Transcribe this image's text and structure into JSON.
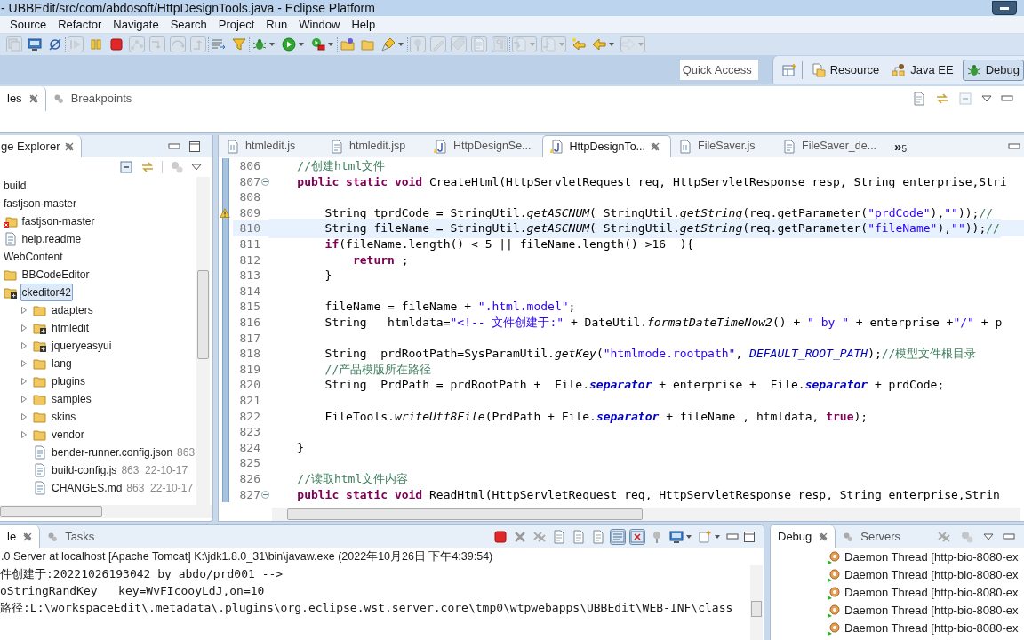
{
  "window": {
    "title": "- UBBEdit/src/com/abdosoft/HttpDesignTools.java - Eclipse Platform"
  },
  "menu": [
    "Source",
    "Refactor",
    "Navigate",
    "Search",
    "Project",
    "Run",
    "Window",
    "Help"
  ],
  "toolbar": [
    [
      {
        "kind": "pages",
        "disabled": true,
        "menu": false
      },
      {
        "kind": "monitor",
        "disabled": false,
        "menu": false
      },
      {
        "kind": "unlink",
        "disabled": false,
        "menu": false
      }
    ],
    [
      {
        "kind": "resume",
        "disabled": true,
        "menu": false
      },
      {
        "kind": "pause",
        "disabled": false,
        "menu": false
      },
      {
        "kind": "stop",
        "disabled": false,
        "menu": false
      },
      {
        "kind": "nodes",
        "disabled": true,
        "menu": false
      },
      {
        "kind": "step-into",
        "disabled": true,
        "menu": false
      },
      {
        "kind": "step-over",
        "disabled": true,
        "menu": false
      },
      {
        "kind": "step-return",
        "disabled": true,
        "menu": false
      }
    ],
    [
      {
        "kind": "list",
        "disabled": false,
        "menu": false
      },
      {
        "kind": "filter",
        "disabled": false,
        "menu": false
      }
    ],
    [
      {
        "kind": "bug",
        "disabled": false,
        "menu": true
      },
      {
        "kind": "run",
        "disabled": false,
        "menu": true
      },
      {
        "kind": "run-tool",
        "disabled": false,
        "menu": true
      }
    ],
    [
      {
        "kind": "folder-new",
        "disabled": false,
        "menu": false
      },
      {
        "kind": "folder",
        "disabled": false,
        "menu": false
      },
      {
        "kind": "brush",
        "disabled": false,
        "menu": true
      }
    ],
    [
      {
        "kind": "pin",
        "disabled": true,
        "menu": false
      },
      {
        "kind": "pen",
        "disabled": true,
        "menu": false
      },
      {
        "kind": "tag",
        "disabled": true,
        "menu": false
      },
      {
        "kind": "doc",
        "disabled": true,
        "menu": false
      },
      {
        "kind": "para",
        "disabled": true,
        "menu": false
      }
    ],
    [
      {
        "kind": "doc-down",
        "disabled": true,
        "menu": true
      },
      {
        "kind": "doc-up",
        "disabled": true,
        "menu": true
      },
      {
        "kind": "arrow-star",
        "disabled": false,
        "menu": false
      },
      {
        "kind": "arrow-left",
        "disabled": false,
        "menu": true
      },
      {
        "kind": "arrow-right",
        "disabled": true,
        "menu": true
      }
    ]
  ],
  "quick_access": {
    "placeholder": "Quick Access"
  },
  "perspectives": [
    {
      "label": "Resource",
      "kind": "resource",
      "selected": false
    },
    {
      "label": "Java EE",
      "kind": "javaee",
      "selected": false
    },
    {
      "label": "Debug",
      "kind": "bug",
      "selected": true
    }
  ],
  "top_view": {
    "tabs": [
      {
        "label": "les",
        "selected": true,
        "closable": true
      },
      {
        "label": "Breakpoints",
        "selected": false,
        "closable": false
      }
    ]
  },
  "package_explorer": {
    "title": "ge Explorer",
    "items": [
      {
        "label": "build",
        "selected": false
      },
      {
        "label": "fastjson-master",
        "selected": false,
        "children": [
          {
            "label": "fastjson-master",
            "kind": "project",
            "selected": false
          },
          {
            "label": "help.readme",
            "kind": "file",
            "selected": false
          }
        ]
      },
      {
        "label": "WebContent",
        "selected": false,
        "children": [
          {
            "label": "BBCodeEditor",
            "kind": "folder",
            "selected": false
          },
          {
            "label": "ckeditor42",
            "kind": "package",
            "selected": true,
            "children": [
              {
                "label": "adapters",
                "kind": "folder",
                "selected": false,
                "expanded": false
              },
              {
                "label": "htmledit",
                "kind": "package",
                "selected": false,
                "expanded": false
              },
              {
                "label": "jqueryeasyui",
                "kind": "package",
                "selected": false,
                "expanded": false
              },
              {
                "label": "lang",
                "kind": "folder",
                "selected": false,
                "expanded": false
              },
              {
                "label": "plugins",
                "kind": "folder",
                "selected": false,
                "expanded": false
              },
              {
                "label": "samples",
                "kind": "folder",
                "selected": false,
                "expanded": false
              },
              {
                "label": "skins",
                "kind": "folder",
                "selected": false,
                "expanded": false
              },
              {
                "label": "vendor",
                "kind": "folder",
                "selected": false,
                "expanded": false
              },
              {
                "label": "bender-runner.config.json",
                "suffix": "863",
                "kind": "file",
                "selected": false
              },
              {
                "label": "build-config.js",
                "suffix": "863  22-10-17",
                "kind": "file",
                "selected": false
              },
              {
                "label": "CHANGES.md",
                "suffix": "863  22-10-17",
                "kind": "file",
                "selected": false
              }
            ]
          }
        ]
      }
    ]
  },
  "editor": {
    "tabs": [
      {
        "label": "htmledit.js",
        "selected": false
      },
      {
        "label": "htmledit.jsp",
        "selected": false
      },
      {
        "label": "HttpDesignSe...",
        "selected": false
      },
      {
        "label": "HttpDesignTo...",
        "selected": true
      },
      {
        "label": "FileSaver.js",
        "selected": false
      },
      {
        "label": "FileSaver_de...",
        "selected": false
      }
    ],
    "overflow": {
      "glyph": "»",
      "count": "5"
    },
    "lines": [
      {
        "no": "806",
        "kind": "plain",
        "current": false,
        "tokens": [
          {
            "kind": "com",
            "text": "    //创建html文件"
          }
        ]
      },
      {
        "no": "807",
        "kind": "fold",
        "current": false,
        "tokens": [
          {
            "kind": "kw",
            "text": "    public static void"
          },
          {
            "kind": "p",
            "text": " CreateHtml(HttpServletRequest req, HttpServletResponse resp, String enterprise,Stri"
          }
        ]
      },
      {
        "no": "808",
        "kind": "plain",
        "current": false
      },
      {
        "no": "809",
        "kind": "warning",
        "current": false,
        "tokens": [
          {
            "kind": "p",
            "text": "        String "
          },
          {
            "kind": "warn",
            "text": "tprdCode"
          },
          {
            "kind": "p",
            "text": " = StringUtil."
          },
          {
            "kind": "sm",
            "text": "getASCNUM"
          },
          {
            "kind": "p",
            "text": "( StringUtil."
          },
          {
            "kind": "sm",
            "text": "getString"
          },
          {
            "kind": "p",
            "text": "(req.getParameter("
          },
          {
            "kind": "str",
            "text": "\"prdCode\""
          },
          {
            "kind": "p",
            "text": "),"
          },
          {
            "kind": "str",
            "text": "\"\""
          },
          {
            "kind": "p",
            "text": "));"
          },
          {
            "kind": "com",
            "text": "//"
          }
        ]
      },
      {
        "no": "810",
        "kind": "plain",
        "current": true,
        "tokens": [
          {
            "kind": "p",
            "text": "        String fileName = StringUtil."
          },
          {
            "kind": "sm",
            "text": "getASCNUM"
          },
          {
            "kind": "p",
            "text": "( StringUtil."
          },
          {
            "kind": "sm",
            "text": "getString"
          },
          {
            "kind": "p",
            "text": "(req.getParameter("
          },
          {
            "kind": "str",
            "text": "\"fileName\""
          },
          {
            "kind": "p",
            "text": "),"
          },
          {
            "kind": "str",
            "text": "\"\""
          },
          {
            "kind": "p",
            "text": "));"
          },
          {
            "kind": "com",
            "text": "//"
          }
        ]
      },
      {
        "no": "811",
        "kind": "plain",
        "current": false,
        "tokens": [
          {
            "kind": "kw",
            "text": "        if"
          },
          {
            "kind": "p",
            "text": "(fileName.length() < 5 || fileName.length() >16  ){"
          }
        ]
      },
      {
        "no": "812",
        "kind": "plain",
        "current": false,
        "tokens": [
          {
            "kind": "kw",
            "text": "            return"
          },
          {
            "kind": "p",
            "text": " ;"
          }
        ]
      },
      {
        "no": "813",
        "kind": "plain",
        "current": false,
        "tokens": [
          {
            "kind": "p",
            "text": "        }"
          }
        ]
      },
      {
        "no": "814",
        "kind": "plain",
        "current": false
      },
      {
        "no": "815",
        "kind": "plain",
        "current": false,
        "tokens": [
          {
            "kind": "p",
            "text": "        fileName = fileName + "
          },
          {
            "kind": "str",
            "text": "\".html.model\""
          },
          {
            "kind": "p",
            "text": ";"
          }
        ]
      },
      {
        "no": "816",
        "kind": "plain",
        "current": false,
        "tokens": [
          {
            "kind": "p",
            "text": "        String   htmldata="
          },
          {
            "kind": "str",
            "text": "\"<!-- 文件创建于:\""
          },
          {
            "kind": "p",
            "text": " + DateUtil."
          },
          {
            "kind": "sm",
            "text": "formatDateTimeNow2"
          },
          {
            "kind": "p",
            "text": "() + "
          },
          {
            "kind": "str",
            "text": "\" by \""
          },
          {
            "kind": "p",
            "text": " + enterprise +"
          },
          {
            "kind": "str",
            "text": "\"/\""
          },
          {
            "kind": "p",
            "text": " + p"
          }
        ]
      },
      {
        "no": "817",
        "kind": "plain",
        "current": false
      },
      {
        "no": "818",
        "kind": "plain",
        "current": false,
        "tokens": [
          {
            "kind": "p",
            "text": "        String  prdRootPath=SysParamUtil."
          },
          {
            "kind": "sm",
            "text": "getKey"
          },
          {
            "kind": "p",
            "text": "("
          },
          {
            "kind": "str",
            "text": "\"htmlmode.rootpath\""
          },
          {
            "kind": "p",
            "text": ", "
          },
          {
            "kind": "cn",
            "text": "DEFAULT_ROOT_PATH"
          },
          {
            "kind": "p",
            "text": ");"
          },
          {
            "kind": "com",
            "text": "//模型文件根目录"
          }
        ]
      },
      {
        "no": "819",
        "kind": "plain",
        "current": false,
        "tokens": [
          {
            "kind": "com",
            "text": "        //产品模版所在路径"
          }
        ]
      },
      {
        "no": "820",
        "kind": "plain",
        "current": false,
        "tokens": [
          {
            "kind": "p",
            "text": "        String  PrdPath = prdRootPath +  File."
          },
          {
            "kind": "sf",
            "text": "separator"
          },
          {
            "kind": "p",
            "text": " + enterprise +  File."
          },
          {
            "kind": "sf",
            "text": "separator"
          },
          {
            "kind": "p",
            "text": " + prdCode;"
          }
        ]
      },
      {
        "no": "821",
        "kind": "plain",
        "current": false
      },
      {
        "no": "822",
        "kind": "plain",
        "current": false,
        "tokens": [
          {
            "kind": "p",
            "text": "        FileTools."
          },
          {
            "kind": "sm",
            "text": "writeUtf8File"
          },
          {
            "kind": "p",
            "text": "(PrdPath + File."
          },
          {
            "kind": "sf",
            "text": "separator"
          },
          {
            "kind": "p",
            "text": " + fileName , htmldata, "
          },
          {
            "kind": "kw",
            "text": "true"
          },
          {
            "kind": "p",
            "text": ");"
          }
        ]
      },
      {
        "no": "823",
        "kind": "plain",
        "current": false
      },
      {
        "no": "824",
        "kind": "plain",
        "current": false,
        "tokens": [
          {
            "kind": "p",
            "text": "    }"
          }
        ]
      },
      {
        "no": "825",
        "kind": "plain",
        "current": false
      },
      {
        "no": "826",
        "kind": "plain",
        "current": false,
        "tokens": [
          {
            "kind": "com",
            "text": "    //读取html文件内容"
          }
        ]
      },
      {
        "no": "827",
        "kind": "fold",
        "current": false,
        "tokens": [
          {
            "kind": "kw",
            "text": "    public static void"
          },
          {
            "kind": "p",
            "text": " ReadHtml(HttpServletRequest req, HttpServletResponse resp, String enterprise,Strin"
          }
        ]
      }
    ]
  },
  "console": {
    "tabs": [
      {
        "label": "le",
        "selected": true,
        "closable": true
      },
      {
        "label": "Tasks",
        "selected": false,
        "closable": false
      }
    ],
    "toolbar": [
      {
        "kind": "stop",
        "pressed": false,
        "menu": false
      },
      {
        "kind": "x",
        "pressed": false,
        "menu": false
      },
      {
        "kind": "xx",
        "pressed": false,
        "menu": false
      },
      {
        "kind": "doc",
        "pressed": false,
        "menu": false
      },
      {
        "kind": "doc",
        "pressed": false,
        "menu": false
      },
      {
        "kind": "doc",
        "pressed": false,
        "menu": false
      },
      {
        "kind": "lock",
        "pressed": true,
        "menu": false
      },
      {
        "kind": "lock-x",
        "pressed": true,
        "menu": false
      },
      {
        "kind": "pin",
        "pressed": false,
        "menu": false
      },
      {
        "kind": "monitor",
        "pressed": false,
        "menu": true
      },
      {
        "kind": "doc-plus",
        "pressed": false,
        "menu": true
      }
    ],
    "header": ".0 Server at localhost [Apache Tomcat] K:\\jdk1.8.0_31\\bin\\javaw.exe (2022年10月26日 下午4:39:54)",
    "lines": [
      "件创建于:20221026193042 by abdo/prd001 -->",
      "oStringRandKey   key=WvFIcooyLdJ,on=10",
      "路径:L:\\workspaceEdit\\.metadata\\.plugins\\org.eclipse.wst.server.core\\tmp0\\wtpwebapps\\UBBEdit\\WEB-INF\\class"
    ]
  },
  "debug": {
    "tabs": [
      {
        "label": "Debug",
        "selected": true,
        "closable": true
      },
      {
        "label": "Servers",
        "selected": false,
        "closable": false
      }
    ],
    "threads": [
      "Daemon Thread [http-bio-8080-ex",
      "Daemon Thread [http-bio-8080-ex",
      "Daemon Thread [http-bio-8080-ex",
      "Daemon Thread [http-bio-8080-ex",
      "Daemon Thread [http-bio-8080-ex"
    ]
  }
}
